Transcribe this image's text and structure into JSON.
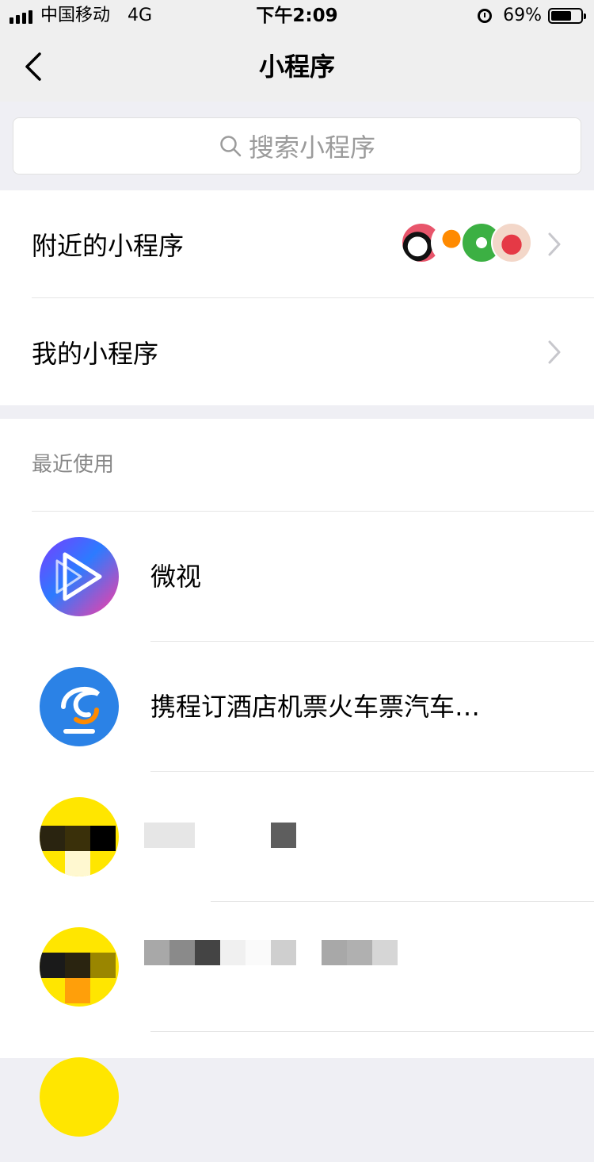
{
  "status_bar": {
    "carrier": "中国移动",
    "network": "4G",
    "time": "下午2:09",
    "battery_percent": "69%",
    "battery_level": 0.69
  },
  "nav": {
    "title": "小程序"
  },
  "search": {
    "placeholder": "搜索小程序"
  },
  "menu": {
    "nearby_label": "附近的小程序",
    "mine_label": "我的小程序"
  },
  "recent": {
    "header": "最近使用",
    "items": [
      {
        "name": "微视",
        "icon": "weishi-icon"
      },
      {
        "name": "携程订酒店机票火车票汽车…",
        "icon": "ctrip-icon"
      },
      {
        "name": "",
        "icon": "pixelated-icon"
      },
      {
        "name": "",
        "icon": "pixelated-icon"
      },
      {
        "name": "",
        "icon": "pixelated-icon"
      }
    ]
  },
  "colors": {
    "background": "#efeff4",
    "cell_bg": "#ffffff",
    "secondary_text": "#888888",
    "chevron": "#c7c7cc"
  }
}
